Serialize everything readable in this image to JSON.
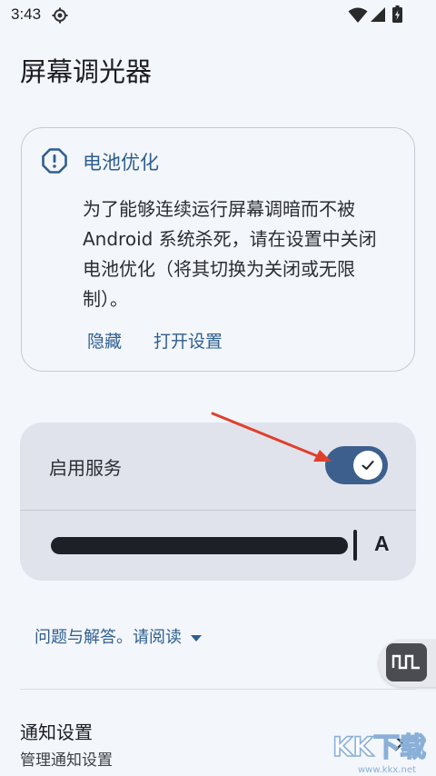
{
  "status_bar": {
    "time": "3:43",
    "icons": [
      "gear-icon",
      "wifi-icon",
      "signal-icon",
      "battery-icon"
    ]
  },
  "app": {
    "title": "屏幕调光器"
  },
  "battery_card": {
    "icon": "alert-circle-icon",
    "title": "电池优化",
    "body": "为了能够连续运行屏幕调暗而不被Android 系统杀死，请在设置中关闭电池优化（将其切换为关闭或无限制）。",
    "hide_button": "隐藏",
    "open_settings_button": "打开设置"
  },
  "service": {
    "label": "启用服务",
    "enabled": true,
    "slider_level": 0.9,
    "slider_trailing_label": "A"
  },
  "faq": {
    "label": "问题与解答。请阅读",
    "icon": "caret-down-icon"
  },
  "notification_settings": {
    "title": "通知设置",
    "subtitle": "管理通知设置",
    "icon": "chevron-right-icon"
  },
  "floating_button": {
    "icon": "square-wave-icon"
  },
  "watermark": {
    "text": "KK下载",
    "url_text": "www.kkx.net"
  },
  "colors": {
    "accent": "#2f5f8f",
    "toggle_on": "#3d5f8d",
    "background": "#f3f6fb",
    "panel": "#e1e3ec",
    "annotation_arrow": "#e0402b"
  }
}
